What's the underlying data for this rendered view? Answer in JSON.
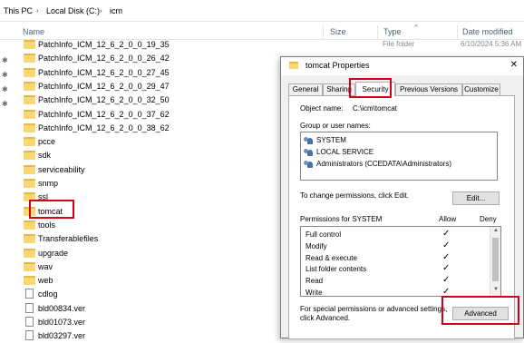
{
  "address": {
    "crumbs": [
      "This PC",
      "Local Disk (C:)",
      "icm"
    ]
  },
  "columns": {
    "name": "Name",
    "size": "Size",
    "type": "Type",
    "date": "Date modified"
  },
  "ghost": {
    "type_1": "File folder",
    "date_1": "6/10/2024 5:36 AM"
  },
  "files": [
    {
      "name": "PatchInfo_ICM_12_6_2_0_0_19_35",
      "kind": "folder"
    },
    {
      "name": "PatchInfo_ICM_12_6_2_0_0_26_42",
      "kind": "folder"
    },
    {
      "name": "PatchInfo_ICM_12_6_2_0_0_27_45",
      "kind": "folder"
    },
    {
      "name": "PatchInfo_ICM_12_6_2_0_0_29_47",
      "kind": "folder"
    },
    {
      "name": "PatchInfo_ICM_12_6_2_0_0_32_50",
      "kind": "folder"
    },
    {
      "name": "PatchInfo_ICM_12_6_2_0_0_37_62",
      "kind": "folder"
    },
    {
      "name": "PatchInfo_ICM_12_6_2_0_0_38_62",
      "kind": "folder"
    },
    {
      "name": "pcce",
      "kind": "folder"
    },
    {
      "name": "sdk",
      "kind": "folder"
    },
    {
      "name": "serviceability",
      "kind": "folder"
    },
    {
      "name": "snmp",
      "kind": "folder"
    },
    {
      "name": "ssl",
      "kind": "folder"
    },
    {
      "name": "tomcat",
      "kind": "folder"
    },
    {
      "name": "tools",
      "kind": "folder"
    },
    {
      "name": "Transferablefiles",
      "kind": "folder"
    },
    {
      "name": "upgrade",
      "kind": "folder"
    },
    {
      "name": "wav",
      "kind": "folder"
    },
    {
      "name": "web",
      "kind": "folder"
    },
    {
      "name": "cdlog",
      "kind": "file"
    },
    {
      "name": "bld00834.ver",
      "kind": "file"
    },
    {
      "name": "bld01073.ver",
      "kind": "file"
    },
    {
      "name": "bld03297.ver",
      "kind": "file"
    }
  ],
  "dialog": {
    "title": "tomcat Properties",
    "close": "✕",
    "tabs": [
      "General",
      "Sharing",
      "Security",
      "Previous Versions",
      "Customize"
    ],
    "object_label": "Object name:",
    "object_value": "C:\\icm\\tomcat",
    "group_label": "Group or user names:",
    "users": [
      "SYSTEM",
      "LOCAL SERVICE",
      "Administrators (CCEDATA\\Administrators)"
    ],
    "change_text": "To change permissions, click Edit.",
    "edit_btn": "Edit...",
    "perm_header": "Permissions for SYSTEM",
    "allow": "Allow",
    "deny": "Deny",
    "permissions": [
      "Full control",
      "Modify",
      "Read & execute",
      "List folder contents",
      "Read",
      "Write"
    ],
    "check": "✓",
    "special_text_1": "For special permissions or advanced settings,",
    "special_text_2": "click Advanced.",
    "advanced_btn": "Advanced"
  },
  "colors": {
    "highlight": "#d0021b",
    "folder": "#f8d775"
  }
}
